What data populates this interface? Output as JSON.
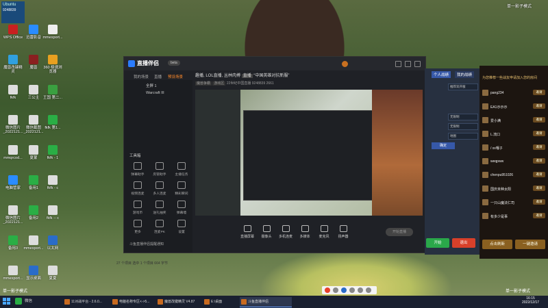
{
  "top_left": {
    "title": "Ubuntu",
    "id": "9248839"
  },
  "desktop_icons": [
    {
      "label": "WPS Office",
      "color": "#c82020"
    },
    {
      "label": "迅雷影音",
      "color": "#2a8cff"
    },
    {
      "label": "mmexport...",
      "color": "#eeeeee"
    },
    {
      "label": "魔兽改键精灵",
      "color": "#30a0e0"
    },
    {
      "label": "魔兽",
      "color": "#8a2020"
    },
    {
      "label": "360 极速浏览器",
      "color": "#e8a020"
    },
    {
      "label": "fkfk",
      "color": "#dddddd"
    },
    {
      "label": "三公主",
      "color": "#dddddd"
    },
    {
      "label": "王国 第二...",
      "color": "#3aa040"
    },
    {
      "label": "微信图片_2022121...",
      "color": "#dddddd"
    },
    {
      "label": "微信截图_2022121...",
      "color": "#dddddd"
    },
    {
      "label": "fkfk 第1...",
      "color": "#2aae45"
    },
    {
      "label": "mmqrcod...",
      "color": "#dddddd"
    },
    {
      "label": "夏蒙",
      "color": "#dddddd"
    },
    {
      "label": "fkfk - 1",
      "color": "#2aae45"
    },
    {
      "label": "电脑管家",
      "color": "#2a8cff"
    },
    {
      "label": "备用1",
      "color": "#2aae45"
    },
    {
      "label": "fkfk - c",
      "color": "#dddddd"
    },
    {
      "label": "微信图片_2022121...",
      "color": "#dddddd"
    },
    {
      "label": "备用2",
      "color": "#2aae45"
    },
    {
      "label": "fkfk -- c",
      "color": "#dddddd"
    },
    {
      "label": "备用3",
      "color": "#2aae45"
    },
    {
      "label": "mmexport...",
      "color": "#dddddd"
    },
    {
      "label": "以太网",
      "color": "#2a6cc8"
    },
    {
      "label": "mmexport...",
      "color": "#dddddd"
    },
    {
      "label": "显示桌面",
      "color": "#2a6cc8"
    },
    {
      "label": "夏夏",
      "color": "#dddddd"
    }
  ],
  "app": {
    "name": "直播伴侣",
    "version": "beta",
    "tabs": [
      "我的场景",
      "直播",
      "预设场景"
    ],
    "scenes": [
      "全屏 1",
      "Warcraft III"
    ],
    "header_title": "趣播, LOL直播, 丛林肉搏",
    "header_tag": "直播",
    "header_extra": "“中国英雄对抗新服”",
    "sub_items": [
      "魔兽争霸",
      "游戏区",
      "22世纪中国直播",
      "9248839",
      "2661"
    ],
    "tools_title": "工具箱",
    "tools": [
      {
        "label": "弹幕助手"
      },
      {
        "label": "房管助手"
      },
      {
        "label": "主播任务"
      },
      {
        "label": "视频连麦"
      },
      {
        "label": "多人连麦"
      },
      {
        "label": "精彩瞬间"
      },
      {
        "label": "游戏币"
      },
      {
        "label": "送礼抽奖"
      },
      {
        "label": "弹幕墙"
      },
      {
        "label": "更多"
      },
      {
        "label": "连麦PK"
      },
      {
        "label": "设置"
      }
    ],
    "bottom_buttons": [
      {
        "label": "直播屏幕"
      },
      {
        "label": "摄像头"
      },
      {
        "label": "多机连麦"
      },
      {
        "label": "多媒体"
      },
      {
        "label": "麦克风"
      },
      {
        "label": "扬声器"
      }
    ],
    "start_label": "开始直播",
    "notice": "斗鱼直播伴侣提醒通知",
    "status": "27 个项目  选中 1 个项目  664 字节"
  },
  "right_panel": {
    "tabs": [
      "个人战绩",
      "我的战绩"
    ],
    "rows": [
      "推荐双开服",
      "无限制",
      "无限制",
      "地图"
    ],
    "confirm": "确定",
    "btn_green": "开始",
    "btn_red": "退出"
  },
  "game_panel": {
    "header": "为您推荐一些战友申请加入您的房间",
    "rows": [
      {
        "name": "pang234"
      },
      {
        "name": "EA1示示示"
      },
      {
        "name": "爱小满"
      },
      {
        "name": "L.流口"
      },
      {
        "name": "/ xx嘎子"
      },
      {
        "name": "weqpww"
      },
      {
        "name": "chenpu951026"
      },
      {
        "name": "国庆未种太阳"
      },
      {
        "name": "一只山魔法仁司"
      },
      {
        "name": "有多少是事"
      }
    ],
    "row_button": "邀请",
    "btn_left": "点击刷新",
    "btn_right": "一键邀请"
  },
  "overlay": {
    "top_right": "单一影子模式",
    "bottom_right": "单一影子模式",
    "bottom_left": "单一影子模式"
  },
  "taskbar": {
    "chat": "微信",
    "tasks": [
      "11对战平台 - 2.6.0...",
      "电脑名称专区<->5...",
      "魔兽改键精灵 V4.87",
      "E:\\桌面",
      "斗鱼直播伴侣"
    ],
    "time": "16:15",
    "date": "2022/12/17"
  }
}
